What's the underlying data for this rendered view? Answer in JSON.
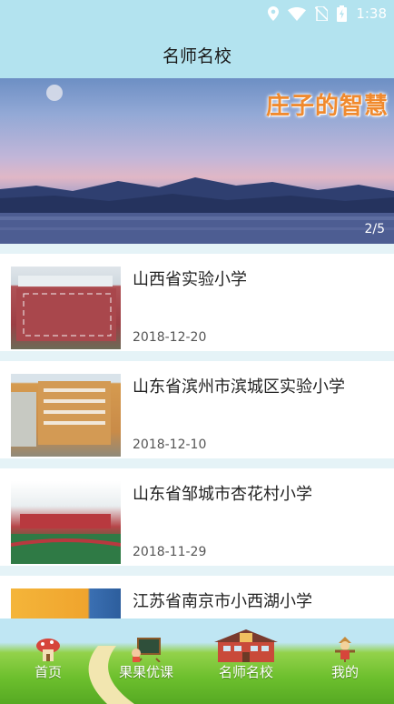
{
  "status_bar": {
    "time": "1:38",
    "icons": [
      "location-icon",
      "wifi-icon",
      "no-sim-icon",
      "battery-charging-icon"
    ]
  },
  "header": {
    "title": "名师名校"
  },
  "banner": {
    "caption": "庄子的智慧",
    "indicator": "2/5"
  },
  "schools": [
    {
      "name": "山西省实验小学",
      "date": "2018-12-20"
    },
    {
      "name": "山东省滨州市滨城区实验小学",
      "date": "2018-12-10"
    },
    {
      "name": "山东省邹城市杏花村小学",
      "date": "2018-11-29"
    },
    {
      "name": "江苏省南京市小西湖小学",
      "date": ""
    }
  ],
  "bottom_nav": [
    {
      "label": "首页",
      "icon": "mushroom-house-icon"
    },
    {
      "label": "果果优课",
      "icon": "chalkboard-icon"
    },
    {
      "label": "名师名校",
      "icon": "school-building-icon",
      "active": true
    },
    {
      "label": "我的",
      "icon": "scarecrow-icon"
    }
  ],
  "colors": {
    "header_bg": "#b3e3ef",
    "list_bg": "#e5f3f7",
    "nav_grass": "#6cbf2d",
    "banner_caption": "#f08a2e"
  }
}
